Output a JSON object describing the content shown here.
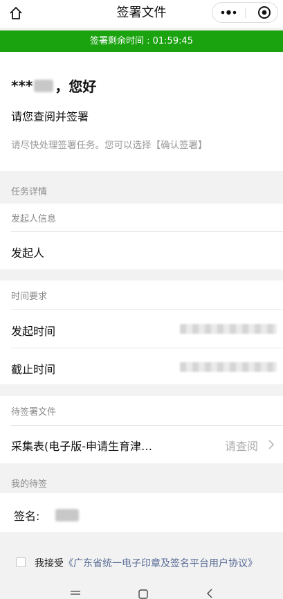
{
  "header": {
    "title": "签署文件",
    "more_icon": "more-dots-icon",
    "close_icon": "target-close-icon"
  },
  "banner": {
    "text": "签署剩余时间 : 01:59:45",
    "color": "#1aa30f"
  },
  "greeting": {
    "name_masked": "***",
    "salutation": "，您好",
    "subtitle": "请您查阅并签署",
    "hint": "请尽快处理签署任务。您可以选择【确认签署】"
  },
  "task": {
    "section_title": "任务详情",
    "initiator_header": "发起人信息",
    "initiator_label": "发起人",
    "time_header": "时间要求",
    "start_label": "发起时间",
    "deadline_label": "截止时间"
  },
  "files": {
    "section_title": "待签署文件",
    "file_name": "采集表(电子版-申请生育津…",
    "view_label": "请查阅"
  },
  "my_sign": {
    "section_title": "我的待签",
    "sign_label": "签名:"
  },
  "agreement": {
    "prefix": "我接受",
    "link": "《广东省统一电子印章及签名平台用户协议》",
    "checked": false
  },
  "colors": {
    "accent": "#1aa30f",
    "link": "#576b95",
    "muted": "#888888"
  }
}
